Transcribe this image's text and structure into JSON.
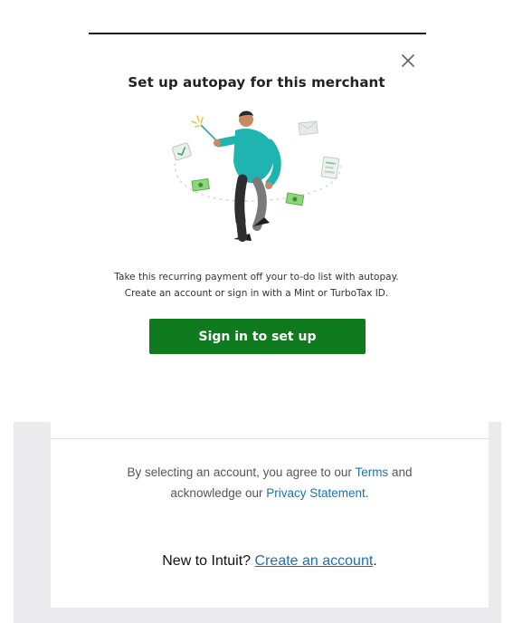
{
  "modal": {
    "title": "Set up autopay for this merchant",
    "description_line1": "Take this recurring payment off your to-do list with autopay.",
    "description_line2": "Create an account or sign in with a Mint or TurboTax ID.",
    "cta_label": "Sign in to set up",
    "close_icon": "close-icon",
    "illustration": "person-with-pointer-illustration"
  },
  "legal": {
    "prefix": "By selecting an account, you agree to our ",
    "terms_link": "Terms",
    "and_text": " and",
    "line2_prefix": "acknowledge our ",
    "privacy_link": "Privacy Statement",
    "period": "."
  },
  "signup": {
    "prompt": "New to Intuit? ",
    "link": "Create an account",
    "period": "."
  },
  "colors": {
    "cta_green": "#0f7a1e",
    "link_blue": "#1f6fb5",
    "figure_teal": "#20b4b0"
  }
}
